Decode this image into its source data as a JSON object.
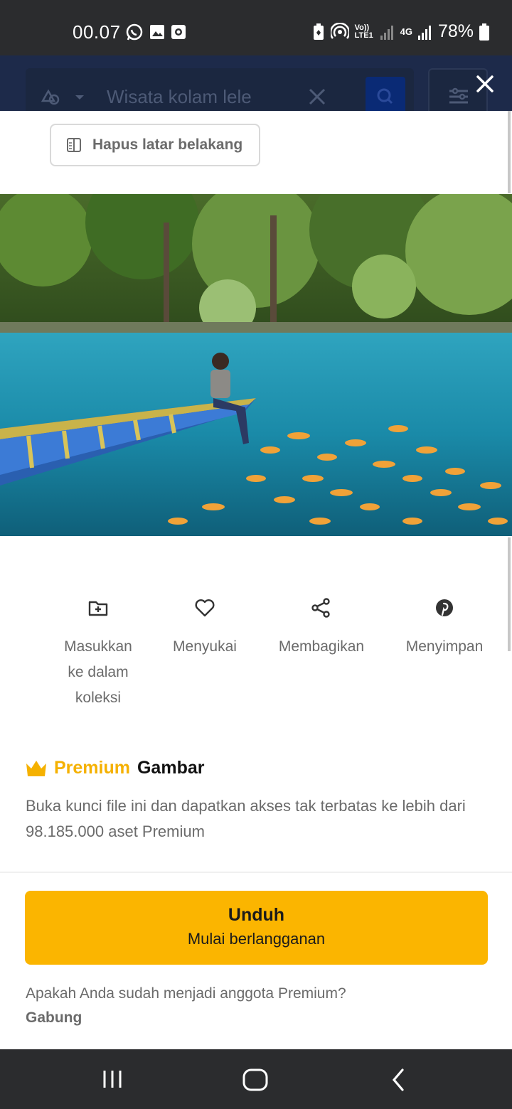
{
  "status_bar": {
    "time": "00.07",
    "battery": "78%",
    "left_icons": [
      "whatsapp-icon",
      "gallery-icon",
      "screen-record-icon"
    ],
    "right_icons": [
      "battery-saver-icon",
      "hotspot-icon",
      "volte-icon",
      "signal-icon",
      "4g-icon",
      "signal-icon",
      "battery-icon"
    ],
    "volte_label": "Vo)) LTE1",
    "network_label": "4G"
  },
  "background_app": {
    "search_text": "Wisata kolam lele"
  },
  "modal": {
    "remove_background_label": "Hapus latar belakang",
    "actions": [
      {
        "label": "Masukkan ke dalam koleksi",
        "icon": "folder-plus-icon"
      },
      {
        "label": "Menyukai",
        "icon": "heart-icon"
      },
      {
        "label": "Membagikan",
        "icon": "share-icon"
      },
      {
        "label": "Menyimpan",
        "icon": "pinterest-icon"
      }
    ],
    "premium": {
      "word": "Premium",
      "type": "Gambar",
      "description": "Buka kunci file ini dan dapatkan akses tak terbatas ke lebih dari 98.185.000 aset Premium"
    },
    "download": {
      "title": "Unduh",
      "subtitle": "Mulai berlangganan"
    },
    "member_question": "Apakah Anda sudah menjadi anggota Premium?",
    "join_label": "Gabung"
  },
  "colors": {
    "accent": "#fbb500",
    "premium_text": "#f5b100",
    "status_bar": "#2b2c2e",
    "header_dim": "#1d2a4a"
  }
}
